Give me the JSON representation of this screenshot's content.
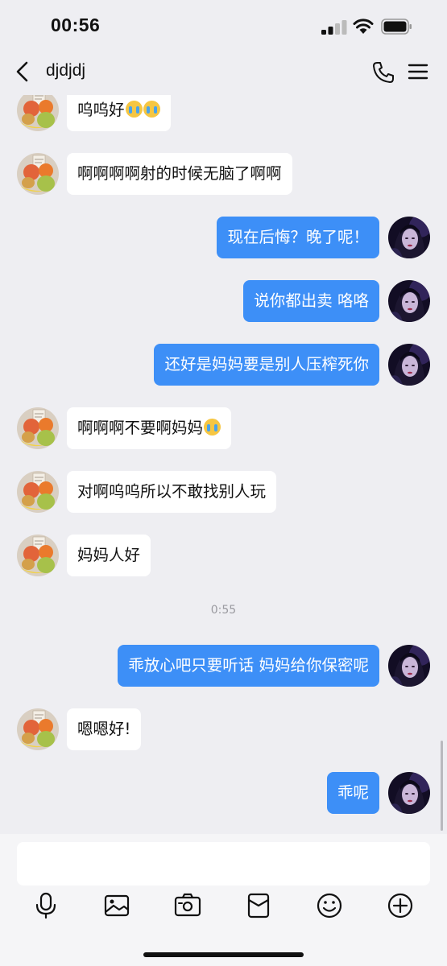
{
  "status_bar": {
    "time": "00:56"
  },
  "header": {
    "title": "djdjdj"
  },
  "messages": [
    {
      "side": "in",
      "text": "呜呜好",
      "emoji_count": 2
    },
    {
      "side": "in",
      "text": "啊啊啊啊射的时候无脑了啊啊"
    },
    {
      "side": "out",
      "text": "现在后悔？晚了呢！"
    },
    {
      "side": "out",
      "text": "说你都出卖 咯咯"
    },
    {
      "side": "out",
      "text": "还好是妈妈要是别人压榨死你"
    },
    {
      "side": "in",
      "text": "啊啊啊不要啊妈妈",
      "emoji_count": 1
    },
    {
      "side": "in",
      "text": "对啊呜呜所以不敢找别人玩"
    },
    {
      "side": "in",
      "text": "妈妈人好"
    },
    {
      "side": "time",
      "text": "0:55"
    },
    {
      "side": "out",
      "text": "乖放心吧只要听话 妈妈给你保密呢"
    },
    {
      "side": "in",
      "text": "嗯嗯好!"
    },
    {
      "side": "out",
      "text": "乖呢"
    }
  ],
  "input": {
    "value": "",
    "placeholder": ""
  },
  "toolbar": [
    "microphone-icon",
    "image-icon",
    "camera-icon",
    "red-packet-icon",
    "emoji-icon",
    "plus-icon"
  ],
  "colors": {
    "outgoing_bubble": "#3d8ff7",
    "incoming_bubble": "#ffffff",
    "background": "#eeeef2"
  }
}
